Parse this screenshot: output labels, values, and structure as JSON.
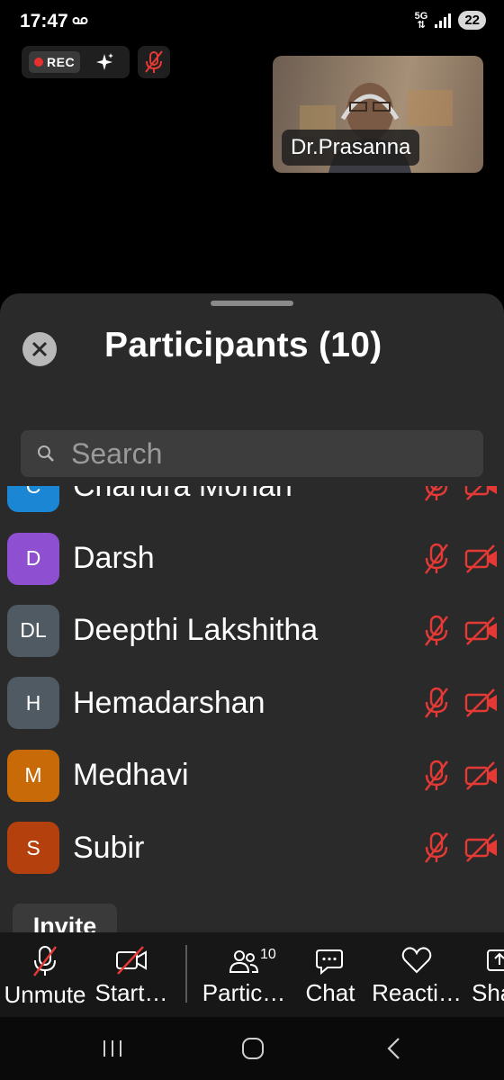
{
  "status_bar": {
    "time": "17:47",
    "network": "5G",
    "battery": "22"
  },
  "top_controls": {
    "rec_label": "REC"
  },
  "video": {
    "participant_name": "Dr.Prasanna"
  },
  "sheet": {
    "title": "Participants (10)",
    "search_placeholder": "Search",
    "participants": [
      {
        "initials": "C",
        "name": "Chandra Mohan",
        "color": "#1b87d4"
      },
      {
        "initials": "D",
        "name": "Darsh",
        "color": "#8f4fd1"
      },
      {
        "initials": "DL",
        "name": "Deepthi Lakshitha",
        "color": "#4f5a63"
      },
      {
        "initials": "H",
        "name": "Hemadarshan",
        "color": "#4f5a63"
      },
      {
        "initials": "M",
        "name": "Medhavi",
        "color": "#c76a07"
      },
      {
        "initials": "S",
        "name": "Subir",
        "color": "#b4400e"
      }
    ],
    "invite_label": "Invite"
  },
  "toolbar": {
    "unmute": "Unmute",
    "start_video": "Start…",
    "participants": "Partic…",
    "participants_count": "10",
    "chat": "Chat",
    "reactions": "Reacti…",
    "share": "Sha"
  },
  "colors": {
    "muted_red": "#e53935",
    "sheet_bg": "#2a2a2a"
  }
}
